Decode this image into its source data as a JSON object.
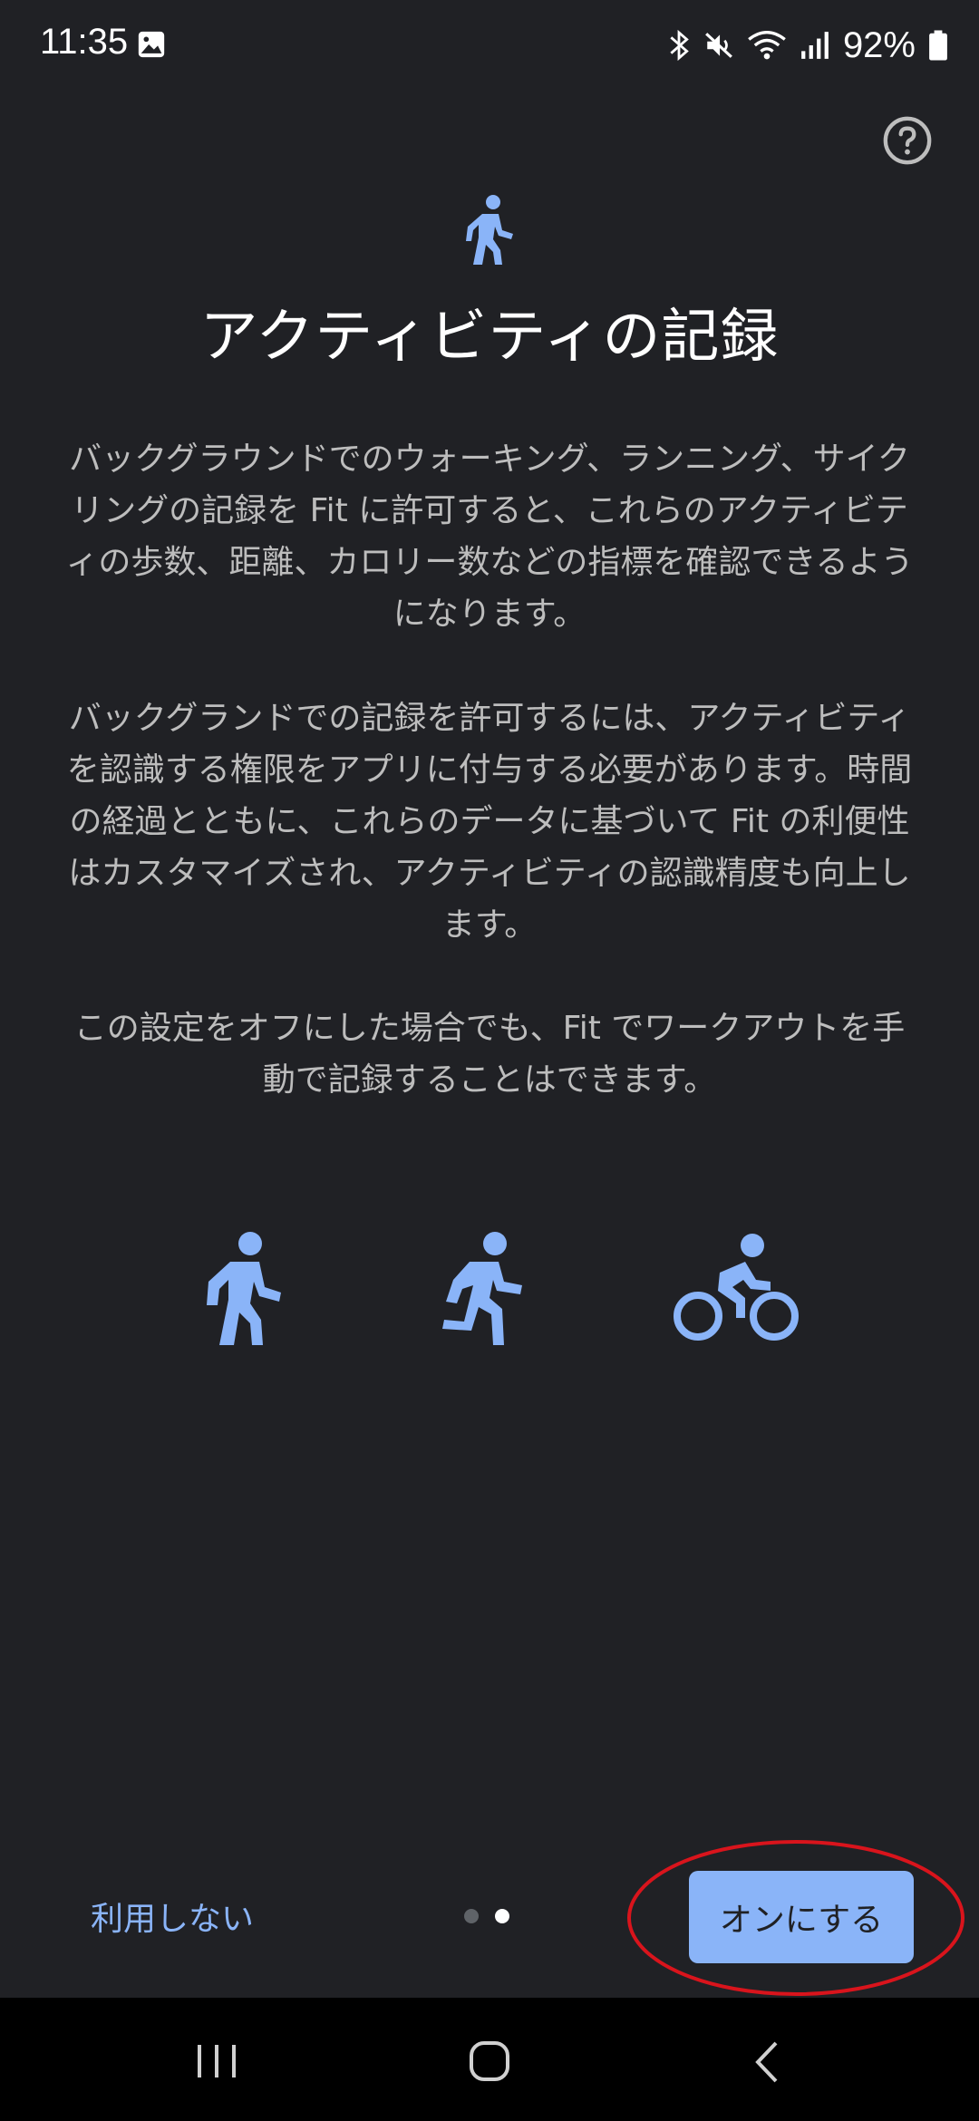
{
  "status_bar": {
    "time": "11:35",
    "battery": "92%",
    "icons": [
      "gallery-icon",
      "bluetooth-icon",
      "mute-icon",
      "wifi-icon",
      "signal-icon",
      "battery-icon"
    ]
  },
  "header": {
    "help_icon": "help-circle-icon",
    "top_icon": "walk-icon"
  },
  "content": {
    "title": "アクティビティの記録",
    "paragraph1": "バックグラウンドでのウォーキング、ランニング、サイクリングの記録を Fit に許可すると、これらのアクティビティの歩数、距離、カロリー数などの指標を確認できるようになります。",
    "paragraph2": "バックグランドでの記録を許可するには、アクティビティを認識する権限をアプリに付与する必要があります。時間の経過とともに、これらのデータに基づいて Fit の利便性はカスタマイズされ、アクティビティの認識精度も向上します。",
    "paragraph3": "この設定をオフにした場合でも、Fit でワークアウトを手動で記録することはできます。",
    "activity_icons": [
      "walk-icon",
      "run-icon",
      "bike-icon"
    ]
  },
  "footer": {
    "skip_label": "利用しない",
    "turn_on_label": "オンにする",
    "page_dots": {
      "count": 2,
      "active_index": 1
    }
  },
  "colors": {
    "background": "#202125",
    "accent": "#8ab4f8",
    "highlight": "#d9141c"
  },
  "nav_bar": {
    "icons": [
      "recent-apps-icon",
      "home-icon",
      "back-icon"
    ]
  }
}
